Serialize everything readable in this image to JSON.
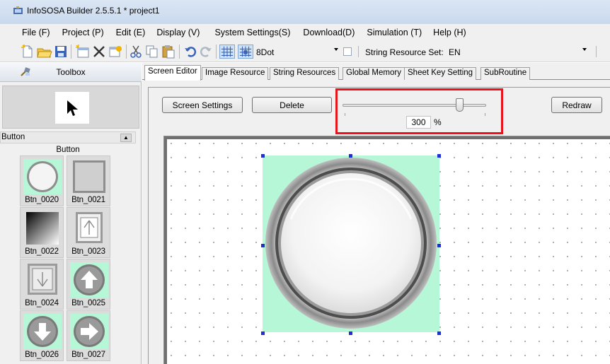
{
  "window": {
    "title": "InfoSOSA Builder 2.5.5.1 * project1"
  },
  "menu": [
    {
      "label": "File (F)"
    },
    {
      "label": "Project (P)"
    },
    {
      "label": "Edit (E)"
    },
    {
      "label": "Display (V)"
    },
    {
      "label": "System Settings(S)"
    },
    {
      "label": "Download(D)"
    },
    {
      "label": "Simulation (T)"
    },
    {
      "label": "Help (H)"
    }
  ],
  "toolbar": {
    "grid_dot_value": "8Dot",
    "string_resource_label": "String Resource Set:",
    "string_resource_value": "EN",
    "icons": [
      "new-icon",
      "open-icon",
      "save-icon",
      "new-screen-icon",
      "delete-icon",
      "properties-icon",
      "cut-icon",
      "copy-icon",
      "paste-icon",
      "undo-icon",
      "redo-icon",
      "grid-icon",
      "snap-grid-icon"
    ]
  },
  "toolbox": {
    "title": "Toolbox",
    "group_name": "Button",
    "group_title": "Button",
    "items": [
      {
        "label": "Btn_0020",
        "icon": "round-button-icon"
      },
      {
        "label": "Btn_0021",
        "icon": "square-button-icon"
      },
      {
        "label": "Btn_0022",
        "icon": "gradient-button-icon"
      },
      {
        "label": "Btn_0023",
        "icon": "up-arrow-button-icon"
      },
      {
        "label": "Btn_0024",
        "icon": "down-arrow-button-icon"
      },
      {
        "label": "Btn_0025",
        "icon": "round-up-arrow-icon"
      },
      {
        "label": "Btn_0026",
        "icon": "round-down-arrow-icon"
      },
      {
        "label": "Btn_0027",
        "icon": "round-right-arrow-icon"
      }
    ]
  },
  "tabs": [
    {
      "label": "Screen Editor",
      "active": true
    },
    {
      "label": "Image Resource"
    },
    {
      "label": "String Resources"
    },
    {
      "label": "Global Memory"
    },
    {
      "label": "Sheet Key Setting"
    },
    {
      "label": "SubRoutine"
    }
  ],
  "editor": {
    "screen_settings_label": "Screen Settings",
    "delete_label": "Delete",
    "redraw_label": "Redraw",
    "zoom_value": "300",
    "zoom_unit": "%",
    "highlight_color": "#e8141b",
    "selection_background": "#b5f7d6"
  }
}
